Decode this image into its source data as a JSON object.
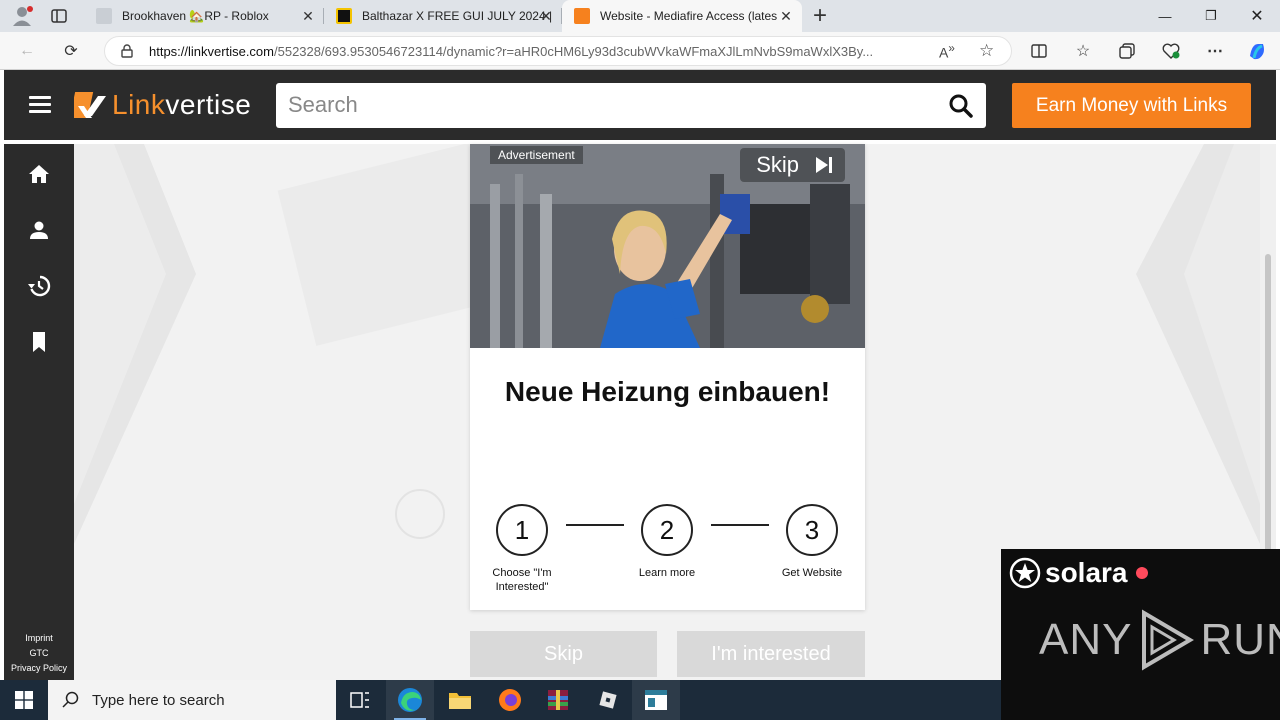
{
  "browser": {
    "tabs": [
      {
        "title": "Brookhaven 🏡RP - Roblox",
        "active": false
      },
      {
        "title": "Balthazar X FREE GUI JULY 2024 | #",
        "active": false
      },
      {
        "title": "Website - Mediafire Access (lates",
        "active": true
      }
    ],
    "new_tab": "+",
    "url_host": "https://linkvertise.com",
    "url_path": "/552328/693.9530546723114/dynamic?r=aHR0cHM6Ly93d3cubWVkaWFmaXJlLmNvbS9maWxlX3By..."
  },
  "site": {
    "brand_first": "Link",
    "brand_rest": "vertise",
    "search_placeholder": "Search",
    "earn_button": "Earn Money with Links",
    "footer_links": [
      "Imprint",
      "GTC",
      "Privacy Policy"
    ]
  },
  "ad": {
    "label": "Advertisement",
    "skip_label": "Skip",
    "headline": "Neue Heizung einbauen!",
    "steps": [
      {
        "number": "1",
        "label": "Choose \"I'm Interested\""
      },
      {
        "number": "2",
        "label": "Learn more"
      },
      {
        "number": "3",
        "label": "Get Website"
      }
    ],
    "skip_button": "Skip",
    "interested_button": "I'm interested"
  },
  "overlay": {
    "solara": "solara",
    "any": "ANY",
    "run": "RUN"
  },
  "taskbar": {
    "search_placeholder": "Type here to search"
  }
}
